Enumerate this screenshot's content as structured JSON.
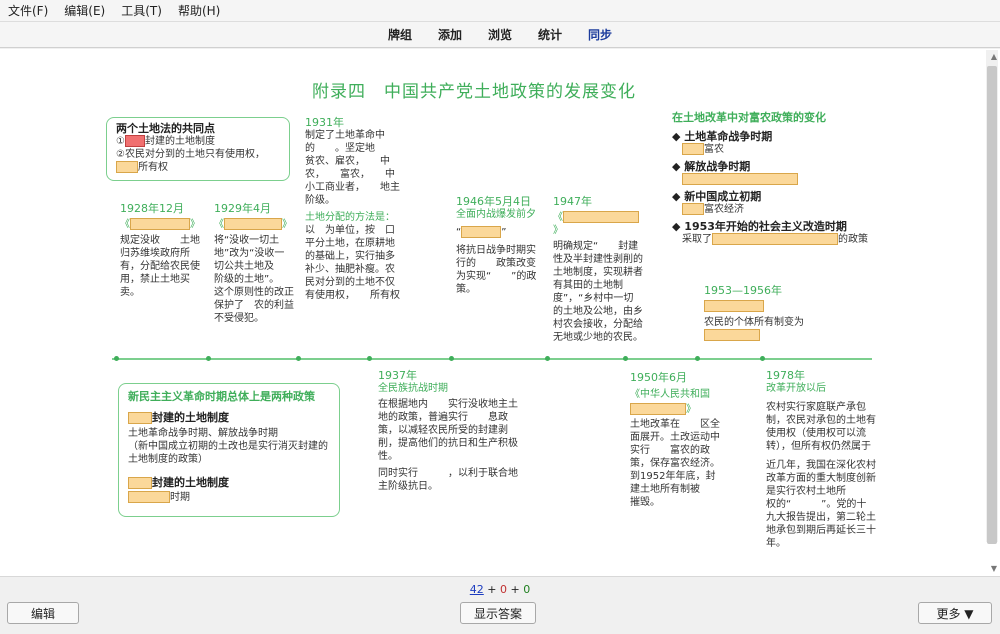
{
  "menu": [
    "文件(F)",
    "编辑(E)",
    "工具(T)",
    "帮助(H)"
  ],
  "tabs": [
    "牌组",
    "添加",
    "浏览",
    "统计",
    "同步"
  ],
  "title": "附录四　中国共产党土地政策的发展变化",
  "common": {
    "heading": "两个土地法的共同点",
    "line1_a": "①",
    "line1_b": "封建的土地制度",
    "line2": "②农民对分到的土地只有使用权，",
    "line3": "所有权"
  },
  "y1928": {
    "date": "1928年12月",
    "text": "规定没收　　土地归苏维埃政府所有，分配给农民使用，禁止土地买卖。"
  },
  "y1929": {
    "date": "1929年4月",
    "text1": "将“没收一切土地”改为“没收一切公共土地及　　阶级的土地”。",
    "text2": "这个原则性的改正保护了　农的利益不受侵犯。"
  },
  "y1931": {
    "date": "1931年",
    "text1": "制定了土地革命中的　　。坚定地　　贫农、雇农，　　中农，　　富农，　　中小工商业者，　　地主阶级。",
    "method": "土地分配的方法是：",
    "text2": "以　为单位，按　口平分土地，在原耕地的基础上，实行抽多补少、抽肥补瘦。农民对分到的土地不仅有使用权，　　所有权"
  },
  "y1946": {
    "date": "1946年5月4日",
    "event": "全面内战爆发前夕",
    "text": "将抗日战争时期实行的　　政策改变为实现“　　”的政策。"
  },
  "y1947": {
    "date": "1947年",
    "text": "明确规定“　　封建性及半封建性剥削的土地制度，实现耕者有其田的土地制度”，“乡村中一切　　的土地及公地，由乡村农会接收，分配给无地或少地的农民。"
  },
  "rich": {
    "heading": "在土地改革中对富农政策的变化",
    "p1": "土地革命战争时期",
    "p1v": "富农",
    "p2": "解放战争时期",
    "p3": "新中国成立初期",
    "p3v": "富农经济",
    "p4": "1953年开始的社会主义改造时期",
    "p4a": "采取了",
    "p4b": "的政策"
  },
  "y1953": {
    "date": "1953—1956年",
    "text": "农民的个体所有制变为"
  },
  "stage": {
    "heading": "新民主主义革命时期总体上是两种政策",
    "a": "封建的土地制度",
    "a1": "土地革命战争时期、解放战争时期",
    "a2": "（新中国成立初期的土改也是实行消灭封建的土地制度的政策）",
    "b": "封建的土地制度",
    "b1": "时期"
  },
  "y1937": {
    "date": "1937年",
    "event": "全民族抗战时期",
    "text1": "在根据地内　　实行没收地主土地的政策，普遍实行　　息政策，以减轻农民所受的封建剥削，提高他们的抗日和生产积极性。",
    "text2": "同时实行　　　，以利于联合地主阶级抗日。"
  },
  "y1950": {
    "date": "1950年6月",
    "event": "《中华人民共和国",
    "text": "土地改革在　　区全面展开。土改运动中实行　　富农的政策，保存富农经济。到1952年年底，封建土地所有制被　　摧毁。"
  },
  "y1978": {
    "date": "1978年",
    "event": "改革开放以后",
    "text1": "农村实行家庭联产承包制，农民对承包的土地有使用权（使用权可以流转），但所有权仍然属于　　",
    "text2": "近几年，我国在深化农村改革方面的重大制度创新是实行农村土地所　　　　　权的“　　　”。党的十九大报告提出，第二轮土地承包到期后再延长三十年。"
  },
  "counts": {
    "a": "42",
    "b": "0",
    "c": "0",
    "sep": "+"
  },
  "buttons": {
    "edit": "编辑",
    "show": "显示答案",
    "more": "更多 ▼"
  }
}
